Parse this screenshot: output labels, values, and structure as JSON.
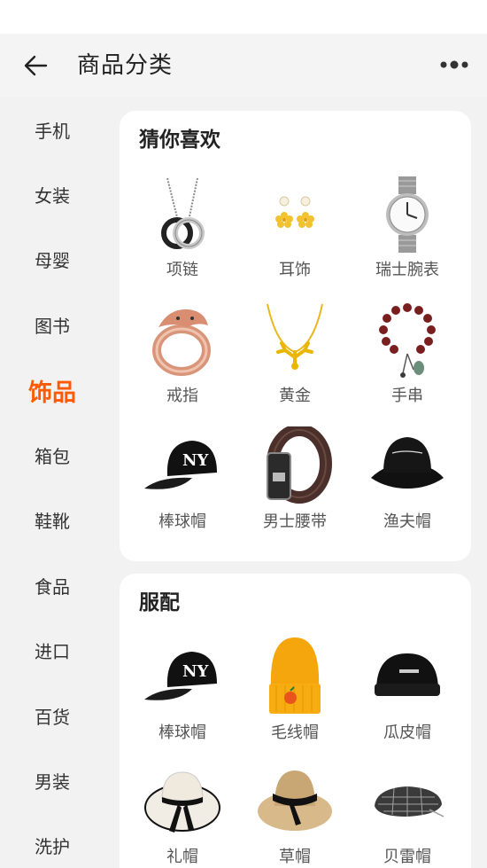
{
  "header": {
    "title": "商品分类"
  },
  "sidebar": {
    "items": [
      {
        "label": "手机"
      },
      {
        "label": "女装"
      },
      {
        "label": "母婴"
      },
      {
        "label": "图书"
      },
      {
        "label": "饰品",
        "active": true
      },
      {
        "label": "箱包"
      },
      {
        "label": "鞋靴"
      },
      {
        "label": "食品"
      },
      {
        "label": "进口"
      },
      {
        "label": "百货"
      },
      {
        "label": "男装"
      },
      {
        "label": "洗护"
      }
    ]
  },
  "sections": [
    {
      "title": "猜你喜欢",
      "products": [
        {
          "label": "项链",
          "icon": "necklace-icon"
        },
        {
          "label": "耳饰",
          "icon": "earring-icon"
        },
        {
          "label": "瑞士腕表",
          "icon": "watch-icon"
        },
        {
          "label": "戒指",
          "icon": "ring-icon"
        },
        {
          "label": "黄金",
          "icon": "gold-necklace-icon"
        },
        {
          "label": "手串",
          "icon": "bead-bracelet-icon"
        },
        {
          "label": "棒球帽",
          "icon": "baseball-cap-icon"
        },
        {
          "label": "男士腰带",
          "icon": "belt-icon"
        },
        {
          "label": "渔夫帽",
          "icon": "bucket-hat-icon"
        }
      ]
    },
    {
      "title": "服配",
      "products": [
        {
          "label": "棒球帽",
          "icon": "baseball-cap-icon"
        },
        {
          "label": "毛线帽",
          "icon": "beanie-icon"
        },
        {
          "label": "瓜皮帽",
          "icon": "skullcap-icon"
        },
        {
          "label": "礼帽",
          "icon": "sun-hat-icon"
        },
        {
          "label": "草帽",
          "icon": "straw-hat-icon"
        },
        {
          "label": "贝雷帽",
          "icon": "beret-icon"
        }
      ]
    }
  ],
  "colors": {
    "accent": "#ff5a00",
    "background": "#f2f2f2",
    "card": "#ffffff"
  }
}
